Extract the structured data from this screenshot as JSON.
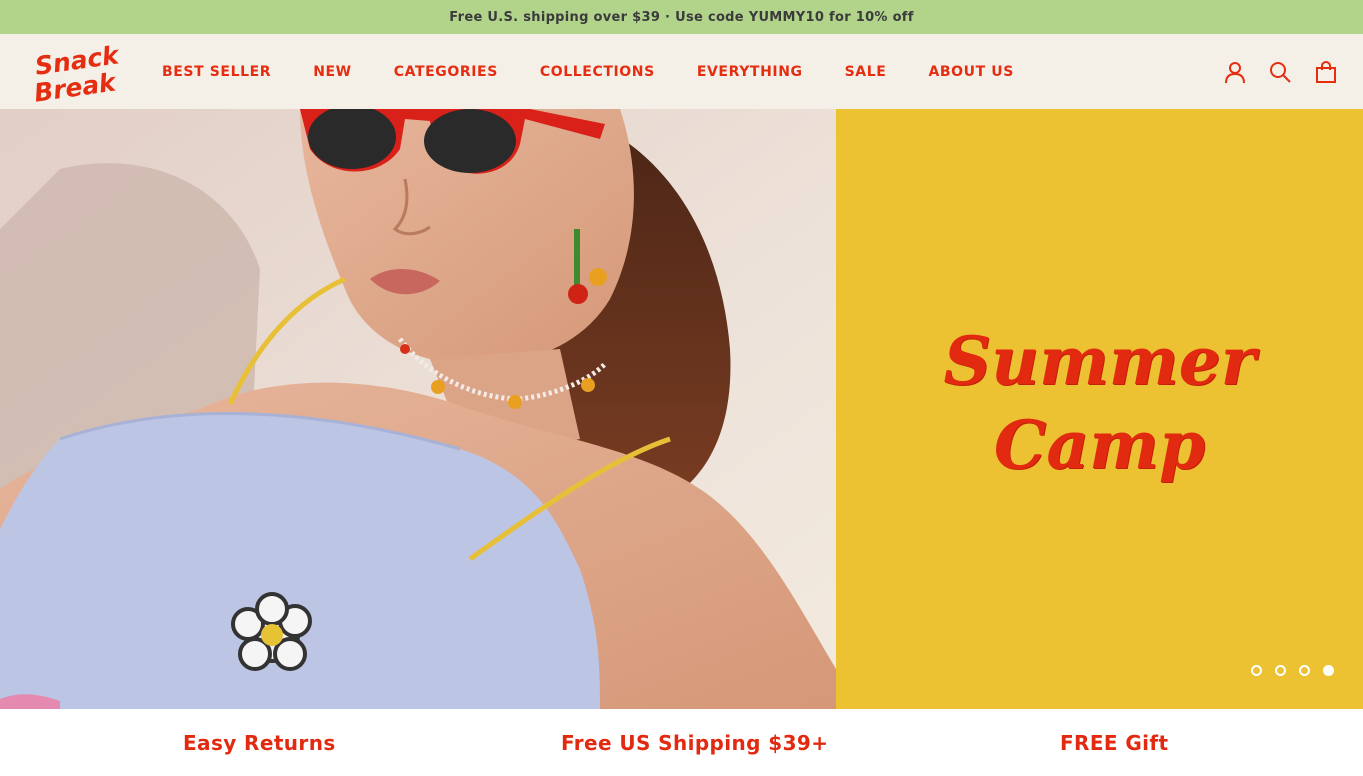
{
  "announcement": {
    "text": "Free U.S. shipping over $39 · Use code YUMMY10 for 10% off"
  },
  "brand": {
    "line1": "Snack",
    "line2": "Break",
    "color": "#e52d12"
  },
  "nav": {
    "items": [
      {
        "label": "BEST SELLER"
      },
      {
        "label": "NEW"
      },
      {
        "label": "CATEGORIES"
      },
      {
        "label": "COLLECTIONS"
      },
      {
        "label": "EVERYTHING"
      },
      {
        "label": "SALE"
      },
      {
        "label": "ABOUT US"
      }
    ]
  },
  "header_icons": [
    "account-icon",
    "search-icon",
    "shopping-bag-icon"
  ],
  "hero": {
    "title_line1": "Summer",
    "title_line2": "Camp",
    "panel_color": "#edc232",
    "slides": {
      "count": 4,
      "active_index": 3
    }
  },
  "features": [
    {
      "label": "Easy Returns"
    },
    {
      "label": "Free US Shipping $39+"
    },
    {
      "label": "FREE Gift"
    }
  ],
  "colors": {
    "accent": "#e22a10",
    "announcement_bg": "#b1d38a",
    "header_bg": "#f4efe7"
  }
}
